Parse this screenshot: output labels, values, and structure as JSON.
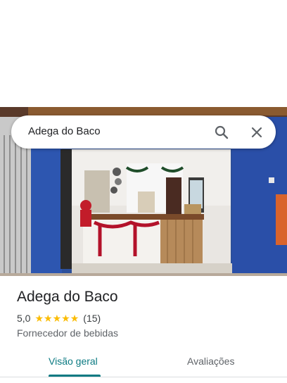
{
  "search": {
    "query": "Adega do Baco"
  },
  "place": {
    "name": "Adega do Baco",
    "rating": "5,0",
    "stars_filled": 5,
    "review_count": "(15)",
    "category": "Fornecedor de bebidas"
  },
  "tabs": [
    {
      "label": "Visão geral",
      "active": true
    },
    {
      "label": "Avaliações",
      "active": false
    }
  ],
  "colors": {
    "accent": "#0b7a82",
    "star": "#fbbc04",
    "wall_blue": "#2c4f9a"
  }
}
